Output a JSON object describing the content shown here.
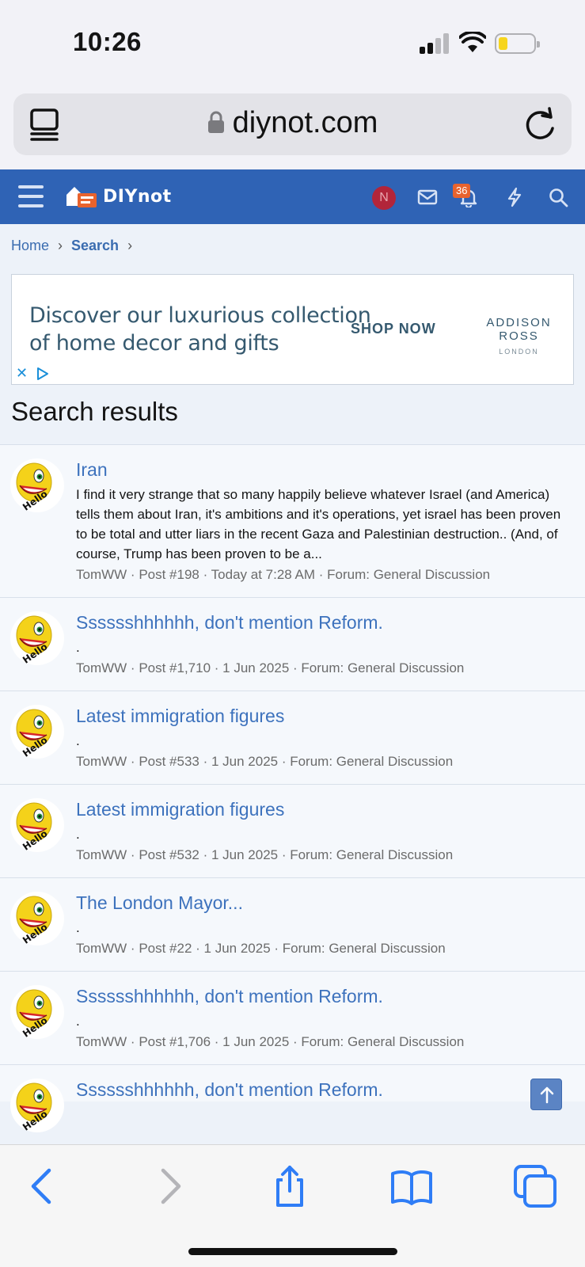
{
  "status": {
    "time": "10:26"
  },
  "browser": {
    "url": "diynot.com",
    "icons": [
      "tabs-overview-icon",
      "lock-icon",
      "reload-icon"
    ]
  },
  "site": {
    "logo_text": "DIYnot",
    "user_initial": "N",
    "alerts_count": "36",
    "accent": "#2f63b5",
    "icons": [
      "menu-icon",
      "inbox-icon",
      "alerts-icon",
      "whats-new-icon",
      "search-icon"
    ]
  },
  "breadcrumb": {
    "home": "Home",
    "current": "Search"
  },
  "ad": {
    "line1": "Discover our luxurious collection",
    "line2": "of home decor and gifts",
    "cta": "SHOP NOW",
    "brand": "ADDISON ROSS",
    "brand_sub": "LONDON",
    "close": "✕"
  },
  "page_title": "Search results",
  "results": [
    {
      "title": "Iran",
      "snippet": "I find it very strange that so many happily believe whatever Israel (and America) tells them about Iran, it's ambitions and it's operations, yet israel has been proven to be total and utter liars in the recent Gaza and Palestinian destruction.. (And, of course, Trump has been proven to be a...",
      "meta": "TomWW · Post #198 · Today at 7:28 AM · Forum: General Discussion"
    },
    {
      "title": "Sssssshhhhhh, don't mention Reform.",
      "snippet": ".",
      "meta": "TomWW · Post #1,710 · 1 Jun 2025 · Forum: General Discussion"
    },
    {
      "title": "Latest immigration figures",
      "snippet": ".",
      "meta": "TomWW · Post #533 · 1 Jun 2025 · Forum: General Discussion"
    },
    {
      "title": "Latest immigration figures",
      "snippet": ".",
      "meta": "TomWW · Post #532 · 1 Jun 2025 · Forum: General Discussion"
    },
    {
      "title": "The London Mayor...",
      "snippet": ".",
      "meta": "TomWW · Post #22 · 1 Jun 2025 · Forum: General Discussion"
    },
    {
      "title": "Sssssshhhhhh, don't mention Reform.",
      "snippet": ".",
      "meta": "TomWW · Post #1,706 · 1 Jun 2025 · Forum: General Discussion"
    },
    {
      "title": "Sssssshhhhhh, don't mention Reform.",
      "snippet": "",
      "meta": ""
    }
  ],
  "avatar_caption": "Hello",
  "toolbar_icons": [
    "back-icon",
    "forward-icon",
    "share-icon",
    "bookmarks-icon",
    "tabs-icon"
  ]
}
